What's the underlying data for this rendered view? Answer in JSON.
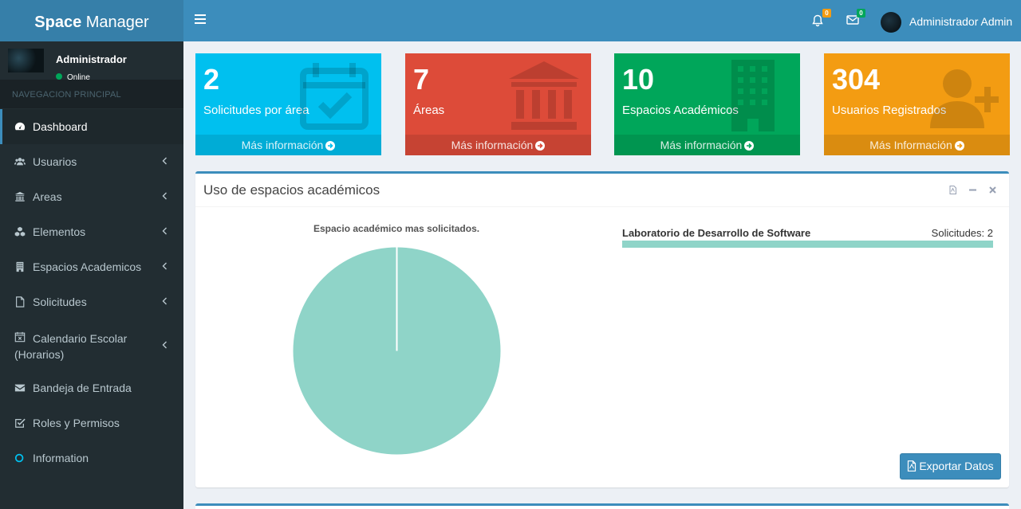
{
  "app": {
    "logo_bold": "Space",
    "logo_light": " Manager"
  },
  "header": {
    "notifications_count": "0",
    "messages_count": "0",
    "user_name": "Administrador Admin",
    "colors": {
      "notif_badge": "#f39c12",
      "msg_badge": "#00a65a"
    }
  },
  "sidebar": {
    "user": {
      "name": "Administrador",
      "status": "Online"
    },
    "section_title": "NAVEGACION PRINCIPAL",
    "items": [
      {
        "label": "Dashboard",
        "icon": "dashboard-icon"
      },
      {
        "label": "Usuarios",
        "icon": "users-icon"
      },
      {
        "label": "Areas",
        "icon": "institution-icon"
      },
      {
        "label": "Elementos",
        "icon": "cubes-icon"
      },
      {
        "label": "Espacios Academicos",
        "icon": "building-icon"
      },
      {
        "label": "Solicitudes",
        "icon": "file-icon"
      },
      {
        "label": "Calendario Escolar (Horarios)",
        "icon": "calendar-icon"
      },
      {
        "label": "Bandeja de Entrada",
        "icon": "envelope-icon"
      },
      {
        "label": "Roles y Permisos",
        "icon": "check-square-icon"
      },
      {
        "label": "Information",
        "icon": "circle-icon"
      }
    ]
  },
  "stats": [
    {
      "value": "2",
      "label": "Solicitudes por área",
      "footer": "Más información",
      "color": "#00c0ef"
    },
    {
      "value": "7",
      "label": "Áreas",
      "footer": "Más información",
      "color": "#dd4b39"
    },
    {
      "value": "10",
      "label": "Espacios Académicos",
      "footer": "Más información",
      "color": "#00a65a"
    },
    {
      "value": "304",
      "label": "Usuarios Registrados",
      "footer": "Más Información",
      "color": "#f39c12"
    }
  ],
  "panel": {
    "title": "Uso de espacios académicos",
    "chart_title": "Espacio académico mas solicitados.",
    "progress": {
      "label": "Laboratorio de Desarrollo de Software",
      "count_text": "Solicitudes: 2",
      "fraction": 1.0
    },
    "export_label": "Exportar Datos"
  },
  "chart_data": {
    "type": "pie",
    "title": "Espacio académico mas solicitados.",
    "categories": [
      "Laboratorio de Desarrollo de Software"
    ],
    "values": [
      2
    ],
    "colors": [
      "#8fd4c8"
    ]
  }
}
